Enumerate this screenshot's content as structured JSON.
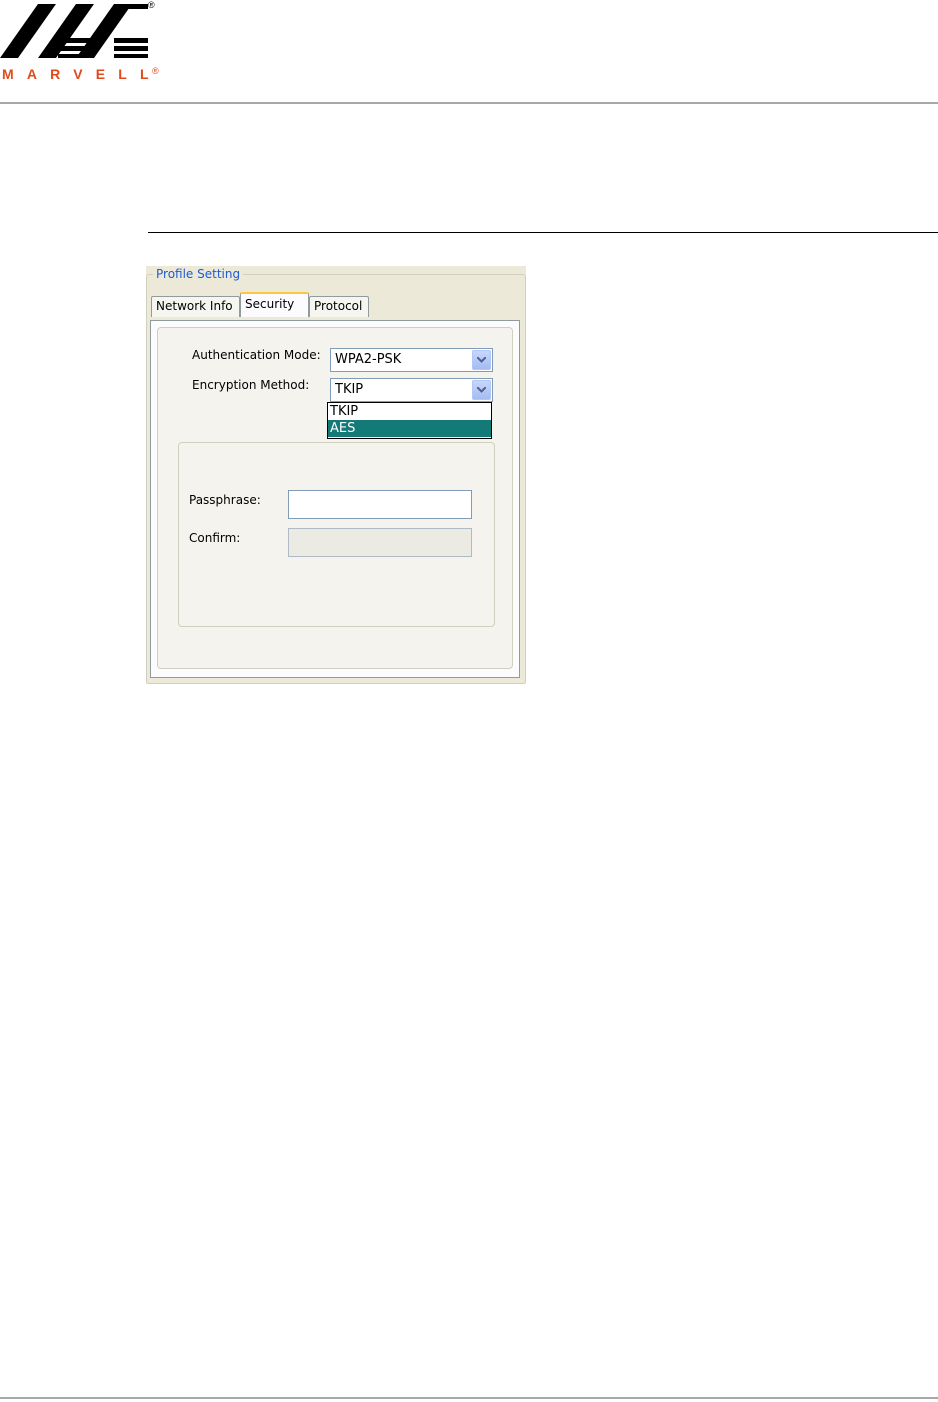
{
  "brand": {
    "wordmark": "MARVELL",
    "registered_mark": "®",
    "accent_color": "#e24a1c"
  },
  "dialog": {
    "group_title": "Profile Setting",
    "tabs": [
      {
        "label": "Network Info",
        "active": false
      },
      {
        "label": "Security",
        "active": true
      },
      {
        "label": "Protocol",
        "active": false
      }
    ],
    "authentication_mode": {
      "label": "Authentication Mode:",
      "value": "WPA2-PSK"
    },
    "encryption_method": {
      "label": "Encryption Method:",
      "value": "TKIP",
      "options": [
        "TKIP",
        "AES"
      ],
      "highlighted": "AES"
    },
    "passphrase": {
      "label": "Passphrase:",
      "value": ""
    },
    "confirm": {
      "label": "Confirm:",
      "value": ""
    },
    "selection_color": "#147a78",
    "legend_color": "#1e5bd6"
  }
}
